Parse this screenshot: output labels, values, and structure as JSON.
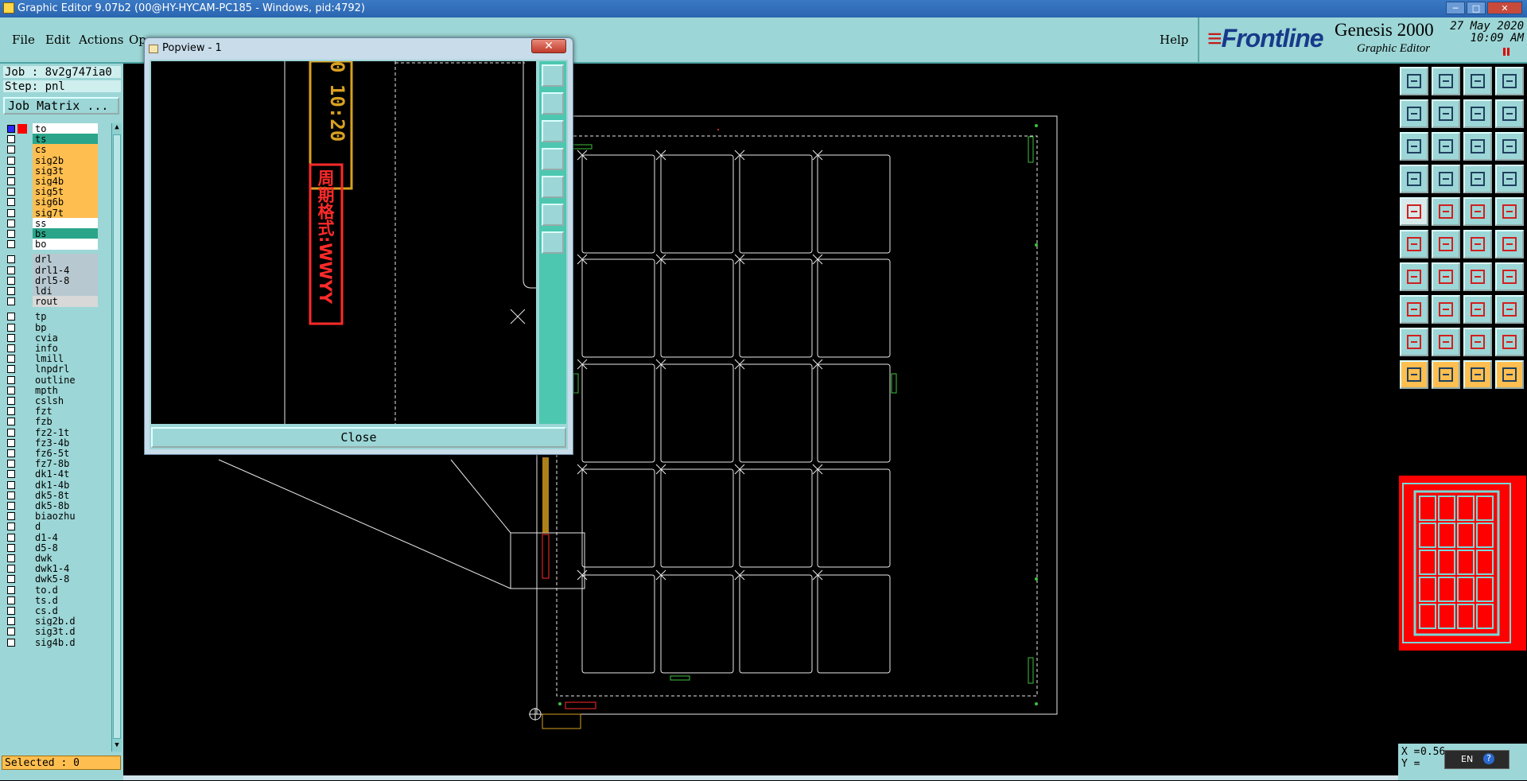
{
  "window": {
    "title": "Graphic Editor 9.07b2 (00@HY-HYCAM-PC185 - Windows, pid:4792)",
    "min_label": "─",
    "max_label": "□",
    "close_label": "✕"
  },
  "menu": {
    "items": [
      "File",
      "Edit",
      "Actions",
      "Op"
    ],
    "help": "Help"
  },
  "brand": {
    "logo_text": "Frontline",
    "logo_mark": "≡",
    "product": "Genesis 2000",
    "subtitle": "Graphic Editor",
    "date": "27 May 2020",
    "time": "10:09 AM"
  },
  "left_panel": {
    "job": "Job : 8v2g747ia0",
    "step": "Step: pnl",
    "job_matrix": "Job Matrix ...",
    "selected": "Selected : 0",
    "layers": [
      {
        "name": "to",
        "color": "#ffffff"
      },
      {
        "name": "ts",
        "color": "#2aa58a"
      },
      {
        "name": "cs",
        "color": "#ffbf50"
      },
      {
        "name": "sig2b",
        "color": "#ffbf50"
      },
      {
        "name": "sig3t",
        "color": "#ffbf50"
      },
      {
        "name": "sig4b",
        "color": "#ffbf50"
      },
      {
        "name": "sig5t",
        "color": "#ffbf50"
      },
      {
        "name": "sig6b",
        "color": "#ffbf50"
      },
      {
        "name": "sig7t",
        "color": "#ffbf50"
      },
      {
        "name": "ss",
        "color": "#ffffff"
      },
      {
        "name": "bs",
        "color": "#2aa58a"
      },
      {
        "name": "bo",
        "color": "#ffffff"
      },
      {
        "name": "drl",
        "color": "#b8c8d0"
      },
      {
        "name": "drl1-4",
        "color": "#b8c8d0"
      },
      {
        "name": "drl5-8",
        "color": "#b8c8d0"
      },
      {
        "name": "ldi",
        "color": "#b8c8d0"
      },
      {
        "name": "rout",
        "color": "#d8d8d8"
      },
      {
        "name": "tp",
        "color": "#9dd6d6"
      },
      {
        "name": "bp",
        "color": "#9dd6d6"
      },
      {
        "name": "cvia",
        "color": "#9dd6d6"
      },
      {
        "name": "info",
        "color": "#9dd6d6"
      },
      {
        "name": "lmill",
        "color": "#9dd6d6"
      },
      {
        "name": "lnpdrl",
        "color": "#9dd6d6"
      },
      {
        "name": "outline",
        "color": "#9dd6d6"
      },
      {
        "name": "mpth",
        "color": "#9dd6d6"
      },
      {
        "name": "cslsh",
        "color": "#9dd6d6"
      },
      {
        "name": "fzt",
        "color": "#9dd6d6"
      },
      {
        "name": "fzb",
        "color": "#9dd6d6"
      },
      {
        "name": "fz2-1t",
        "color": "#9dd6d6"
      },
      {
        "name": "fz3-4b",
        "color": "#9dd6d6"
      },
      {
        "name": "fz6-5t",
        "color": "#9dd6d6"
      },
      {
        "name": "fz7-8b",
        "color": "#9dd6d6"
      },
      {
        "name": "dk1-4t",
        "color": "#9dd6d6"
      },
      {
        "name": "dk1-4b",
        "color": "#9dd6d6"
      },
      {
        "name": "dk5-8t",
        "color": "#9dd6d6"
      },
      {
        "name": "dk5-8b",
        "color": "#9dd6d6"
      },
      {
        "name": "biaozhu",
        "color": "#9dd6d6"
      },
      {
        "name": "d",
        "color": "#9dd6d6"
      },
      {
        "name": "d1-4",
        "color": "#9dd6d6"
      },
      {
        "name": "d5-8",
        "color": "#9dd6d6"
      },
      {
        "name": "dwk",
        "color": "#9dd6d6"
      },
      {
        "name": "dwk1-4",
        "color": "#9dd6d6"
      },
      {
        "name": "dwk5-8",
        "color": "#9dd6d6"
      },
      {
        "name": "to.d",
        "color": "#9dd6d6"
      },
      {
        "name": "ts.d",
        "color": "#9dd6d6"
      },
      {
        "name": "cs.d",
        "color": "#9dd6d6"
      },
      {
        "name": "sig2b.d",
        "color": "#9dd6d6"
      },
      {
        "name": "sig3t.d",
        "color": "#9dd6d6"
      },
      {
        "name": "sig4b.d",
        "color": "#9dd6d6"
      }
    ]
  },
  "popview": {
    "title": "Popview - 1",
    "close_button": "Close",
    "close_x": "✕",
    "vertical_text": "0 10:20",
    "red_text": "周期格式:WWYY"
  },
  "right_panel": {
    "coord_x_label": "X =",
    "coord_y_label": "Y =",
    "coord_x_value": "0.56",
    "lang": "EN",
    "help_glyph": "?"
  }
}
